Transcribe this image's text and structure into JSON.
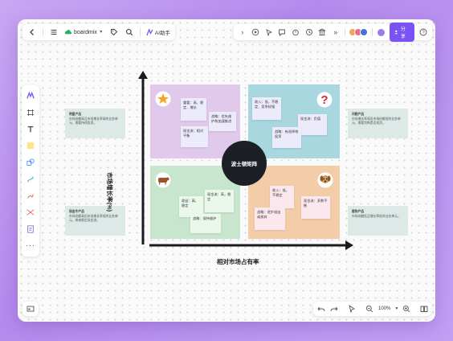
{
  "app": {
    "name": "boardmix",
    "ai_label": "AI助手",
    "share_label": "分享"
  },
  "zoom": "100%",
  "matrix": {
    "center_label": "波士顿矩阵",
    "x_axis_label": "相对市场占有率",
    "y_axis_label": "市场增长率(%)",
    "star_notes": [
      {
        "text": "重要：高、稳定、增长"
      },
      {
        "text": "战略：优先维护和加速推进"
      },
      {
        "text": "现金流：相对平衡"
      }
    ],
    "question_notes": [
      {
        "text": "收入：低，不稳定、竞争较强"
      },
      {
        "text": "现金流：负值"
      },
      {
        "text": "战略：有选择地投资"
      }
    ],
    "cow_notes": [
      {
        "text": "收益：高，稳定"
      },
      {
        "text": "现金流：高，稳定"
      },
      {
        "text": "战略：保持维护"
      }
    ],
    "dog_notes": [
      {
        "text": "收入：低，不稳定"
      },
      {
        "text": "战略：逐步退出或放弃"
      },
      {
        "text": "现金流：多数平衡"
      }
    ],
    "side_panels": {
      "top_left": {
        "title": "明星产品",
        "body": "市场份额高且市场增长率高的业务单元，需要持续投资。"
      },
      "bottom_left": {
        "title": "现金牛产品",
        "body": "市场份额高但市场增长率低的业务单元，带来稳定现金流。"
      },
      "top_right": {
        "title": "问题产品",
        "body": "市场增长率高但市场份额低的业务单元，需要判断是否投资。"
      },
      "bottom_right": {
        "title": "瘦狗产品",
        "body": "市场份额低且增长率低的业务单元。"
      }
    }
  },
  "colors": {
    "star_quadrant": "#e0c9ea",
    "question_quadrant": "#a8d7e0",
    "cow_quadrant": "#c8e6cd",
    "dog_quadrant": "#f2cda8",
    "center": "#1d1f26",
    "accent": "#7b52f3"
  }
}
